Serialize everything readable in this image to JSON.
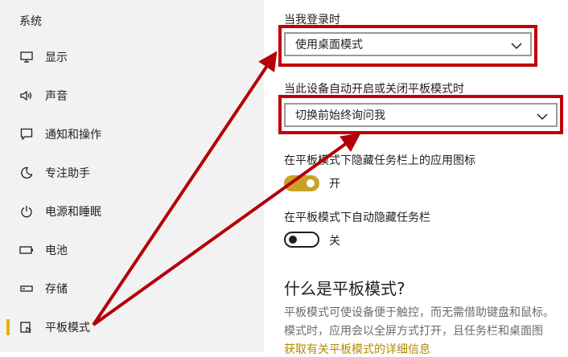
{
  "sidebar": {
    "title": "系统",
    "items": [
      {
        "label": "显示",
        "icon": "monitor-icon"
      },
      {
        "label": "声音",
        "icon": "speaker-icon"
      },
      {
        "label": "通知和操作",
        "icon": "message-icon"
      },
      {
        "label": "专注助手",
        "icon": "moon-icon"
      },
      {
        "label": "电源和睡眠",
        "icon": "power-icon"
      },
      {
        "label": "电池",
        "icon": "battery-icon"
      },
      {
        "label": "存储",
        "icon": "storage-icon"
      },
      {
        "label": "平板模式",
        "icon": "tablet-icon",
        "selected": true
      }
    ]
  },
  "main": {
    "signin_label": "当我登录时",
    "signin_value": "使用桌面模式",
    "switch_label": "当此设备自动开启或关闭平板模式时",
    "switch_value": "切换前始终询问我",
    "hide_icons_label": "在平板模式下隐藏任务栏上的应用图标",
    "hide_icons_state": "开",
    "auto_hide_label": "在平板模式下自动隐藏任务栏",
    "auto_hide_state": "关",
    "heading": "什么是平板模式?",
    "desc_line1": "平板模式可使设备便于触控，而无需借助键盘和鼠标。",
    "desc_line2": "模式时，应用会以全屏方式打开，且任务栏和桌面图",
    "more_link": "获取有关平板模式的详细信息"
  },
  "colors": {
    "accent": "#c9a227",
    "highlight": "#c0000b",
    "sidebar_bg": "#f2f2f2"
  }
}
